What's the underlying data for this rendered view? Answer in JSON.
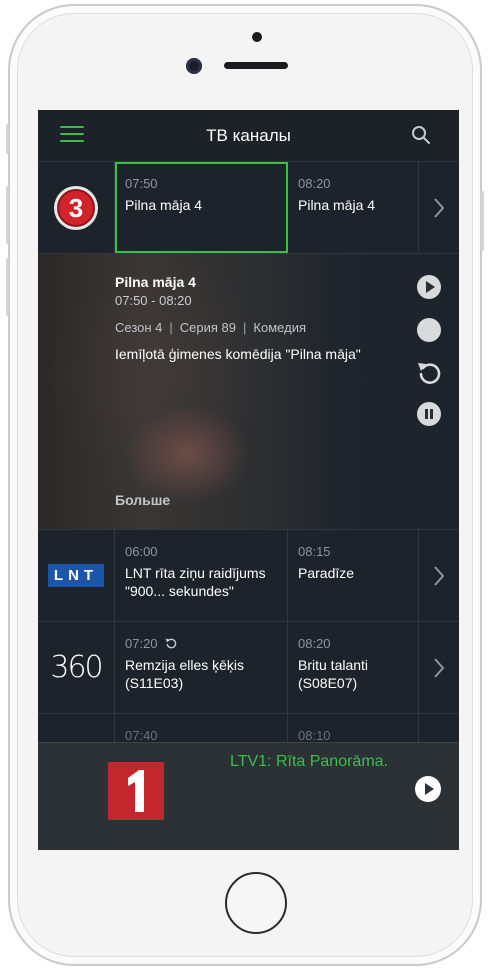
{
  "header": {
    "title": "ТВ каналы"
  },
  "colors": {
    "accent": "#3dbd4a",
    "background": "#1d232a"
  },
  "channels": [
    {
      "logo_text": "3",
      "programs": [
        {
          "time": "07:50",
          "title": "Pilna māja 4"
        },
        {
          "time": "08:20",
          "title": "Pilna māja 4"
        }
      ]
    },
    {
      "logo_text": "LNT",
      "programs": [
        {
          "time": "06:00",
          "title": "LNT rīta ziņu raidījums \"900... sekundes\""
        },
        {
          "time": "08:15",
          "title": "Paradīze"
        }
      ]
    },
    {
      "logo_text": "360",
      "programs": [
        {
          "time": "07:20",
          "title": "Remzija elles ķēķis (S11E03)"
        },
        {
          "time": "08:20",
          "title": "Britu talanti (S08E07)"
        }
      ]
    },
    {
      "programs": [
        {
          "time": "07:40",
          "title": ""
        },
        {
          "time": "08:10",
          "title": ""
        }
      ]
    }
  ],
  "detail": {
    "title": "Pilna māja 4",
    "time_range": "07:50 - 08:20",
    "season": "Сезон 4",
    "episode": "Серия 89",
    "genre": "Комедия",
    "description": "Iemīļotā ģimenes komēdija \"Pilna māja\"",
    "more_label": "Больше"
  },
  "mini_player": {
    "now_playing": "LTV1: Rīta Panorāma."
  }
}
